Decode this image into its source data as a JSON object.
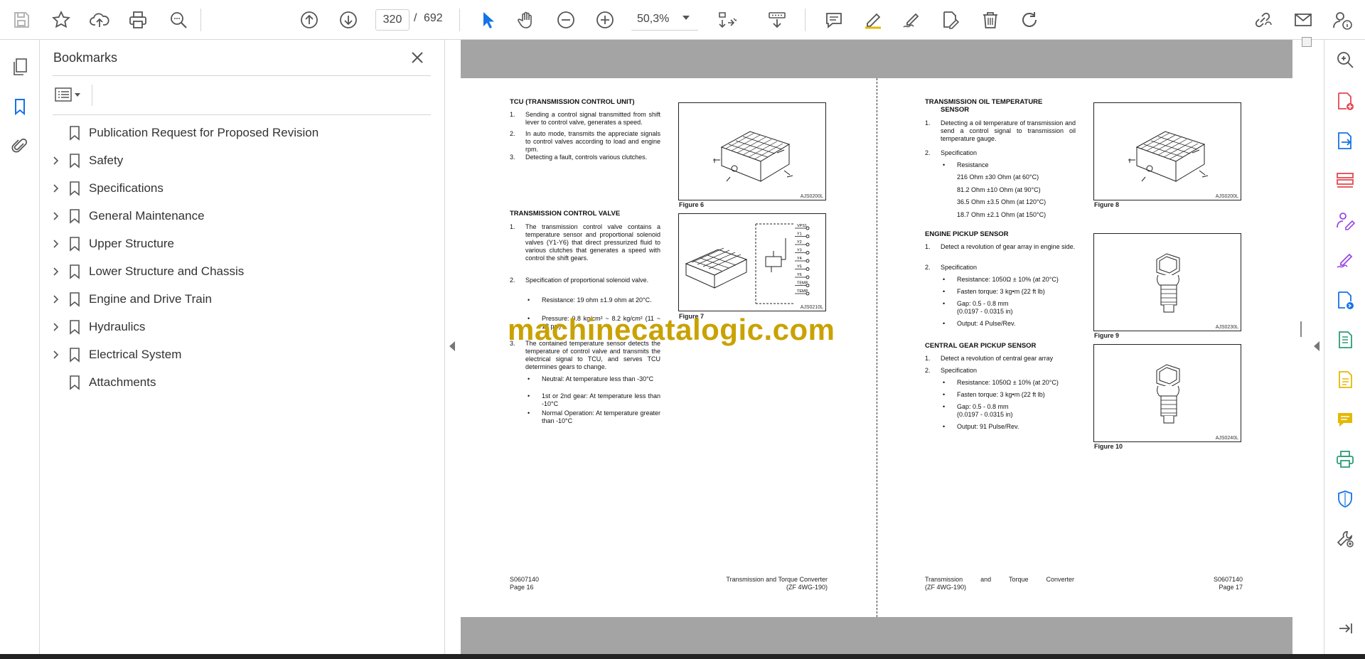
{
  "toolbar": {
    "page_current": "320",
    "page_separator": "/",
    "page_total": "692",
    "zoom": "50,3%"
  },
  "bookmarks": {
    "title": "Bookmarks",
    "items": [
      {
        "label": "Publication Request for Proposed Revision",
        "expandable": false
      },
      {
        "label": "Safety",
        "expandable": true
      },
      {
        "label": "Specifications",
        "expandable": true
      },
      {
        "label": "General Maintenance",
        "expandable": true
      },
      {
        "label": "Upper Structure",
        "expandable": true
      },
      {
        "label": "Lower Structure and Chassis",
        "expandable": true
      },
      {
        "label": "Engine and Drive Train",
        "expandable": true
      },
      {
        "label": "Hydraulics",
        "expandable": true
      },
      {
        "label": "Electrical System",
        "expandable": true
      },
      {
        "label": "Attachments",
        "expandable": false
      }
    ]
  },
  "watermark": "machinecatalogic.com",
  "left_page": {
    "tcu_heading": "TCU (TRANSMISSION CONTROL UNIT)",
    "tcu_items": [
      {
        "n": "1.",
        "t": "Sending a control signal transmitted from shift lever to control valve, generates a speed."
      },
      {
        "n": "2.",
        "t": "In auto mode, transmits the appreciate signals to control valves according to load and engine rpm."
      },
      {
        "n": "3.",
        "t": "Detecting a fault, controls various clutches."
      }
    ],
    "valve_heading": "TRANSMISSION CONTROL VALVE",
    "valve_item1": {
      "n": "1.",
      "t": "The transmission control valve contains a temperature sensor and proportional solenoid valves (Y1-Y6) that direct pressurized fluid to various clutches that generates a speed with control the shift gears."
    },
    "valve_item2": {
      "n": "2.",
      "t": "Specification of proportional solenoid valve."
    },
    "valve_item2_bullets": [
      "Resistance: 19 ohm ±1.9 ohm at 20°C.",
      "Pressure: 0.8 kg/cm² ~ 8.2 kg/cm² (11 ~ 18 psi)"
    ],
    "valve_item3": {
      "n": "3.",
      "t": "The contained temperature sensor detects the temperature of control valve and transmits the electrical signal to TCU, and serves TCU determines gears to change."
    },
    "valve_item3_bullets": [
      "Neutral: At temperature less than -30°C",
      "1st or 2nd gear: At temperature less than -10°C",
      "Normal Operation: At temperature greater than -10°C"
    ],
    "fig6_caption": "Figure 6",
    "fig6_code": "AJS0200L",
    "fig7_caption": "Figure 7",
    "fig7_code": "AJS0210L",
    "fig7_labels": [
      "VPS1",
      "Y1",
      "Y2",
      "Y3",
      "Y4",
      "Y5",
      "Y6",
      "TEMP",
      "TEMP"
    ],
    "footer_code": "S0607140",
    "footer_page": "Page 16",
    "footer_title": "Transmission and Torque Converter",
    "footer_model": "(ZF 4WG-190)"
  },
  "right_page": {
    "oiltemp_heading_l1": "TRANSMISSION OIL TEMPERATURE",
    "oiltemp_heading_l2": "SENSOR",
    "oiltemp_item1": {
      "n": "1.",
      "t": "Detecting a oil temperature of transmission and send a control signal to transmission oil temperature gauge."
    },
    "oiltemp_item2": {
      "n": "2.",
      "t": "Specification"
    },
    "oiltemp_bullet": "Resistance",
    "oiltemp_values": [
      "216 Ohm ±30 Ohm (at 60°C)",
      "81.2 Ohm ±10 Ohm (at 90°C)",
      "36.5 Ohm ±3.5 Ohm (at 120°C)",
      "18.7 Ohm ±2.1 Ohm (at 150°C)"
    ],
    "engine_heading": "ENGINE PICKUP SENSOR",
    "engine_item1": {
      "n": "1.",
      "t": "Detect a revolution of gear array in engine side."
    },
    "engine_item2": {
      "n": "2.",
      "t": "Specification"
    },
    "engine_bullets": [
      "Resistance: 1050Ω ± 10% (at 20°C)",
      "Fasten torque: 3 kg•m (22 ft lb)",
      "Gap: 0.5 - 0.8 mm",
      "Output: 4 Pulse/Rev."
    ],
    "engine_gap_in": "(0.0197 - 0.0315 in)",
    "central_heading": "CENTRAL GEAR PICKUP SENSOR",
    "central_item1": {
      "n": "1.",
      "t": "Detect a revolution of central gear array"
    },
    "central_item2": {
      "n": "2.",
      "t": "Specification"
    },
    "central_bullets": [
      "Resistance: 1050Ω ± 10% (at 20°C)",
      "Fasten torque: 3 kg•m (22 ft lb)",
      "Gap: 0.5 - 0.8 mm",
      "Output: 91 Pulse/Rev."
    ],
    "central_gap_in": "(0.0197 - 0.0315 in)",
    "fig8_caption": "Figure 8",
    "fig8_code": "AJS0200L",
    "fig9_caption": "Figure 9",
    "fig9_code": "AJS0230L",
    "fig10_caption": "Figure 10",
    "fig10_code": "AJS0240L",
    "footer_title": "Transmission and Torque Converter",
    "footer_model": "(ZF 4WG-190)",
    "footer_code": "S0607140",
    "footer_page": "Page 17"
  },
  "icons": {
    "toolbar": [
      "save-icon",
      "bookmark-star-icon",
      "upload-cloud-icon",
      "print-icon",
      "zoom-search-icon",
      "prev-page-icon",
      "next-page-icon",
      "select-cursor-icon",
      "hand-pan-icon",
      "zoom-out-icon",
      "zoom-in-icon",
      "fit-page-icon",
      "scroll-mode-icon",
      "comment-icon",
      "highlight-pen-icon",
      "sign-icon",
      "edit-pdf-icon",
      "delete-icon",
      "rotate-icon",
      "share-link-icon",
      "email-icon",
      "help-user-icon"
    ],
    "rail_left": [
      "pages-thumbnails-icon",
      "bookmarks-icon",
      "attachments-icon"
    ],
    "rail_right": [
      "zoom-search-icon",
      "create-pdf-icon",
      "export-pdf-icon",
      "organize-pages-icon",
      "request-signature-icon",
      "fill-sign-icon",
      "send-track-icon",
      "compress-icon",
      "edit-document-icon",
      "comment-tool-icon",
      "print-production-icon",
      "protect-shield-icon",
      "more-tools-icon",
      "expand-panel-icon"
    ]
  },
  "colors": {
    "accent_blue": "#1473e6",
    "tool_red": "#e34850",
    "tool_purple": "#9a47e2",
    "tool_green": "#2d9d78",
    "tool_yellow": "#e6b800",
    "watermark": "#c9a200",
    "page_gray": "#a4a4a4"
  }
}
